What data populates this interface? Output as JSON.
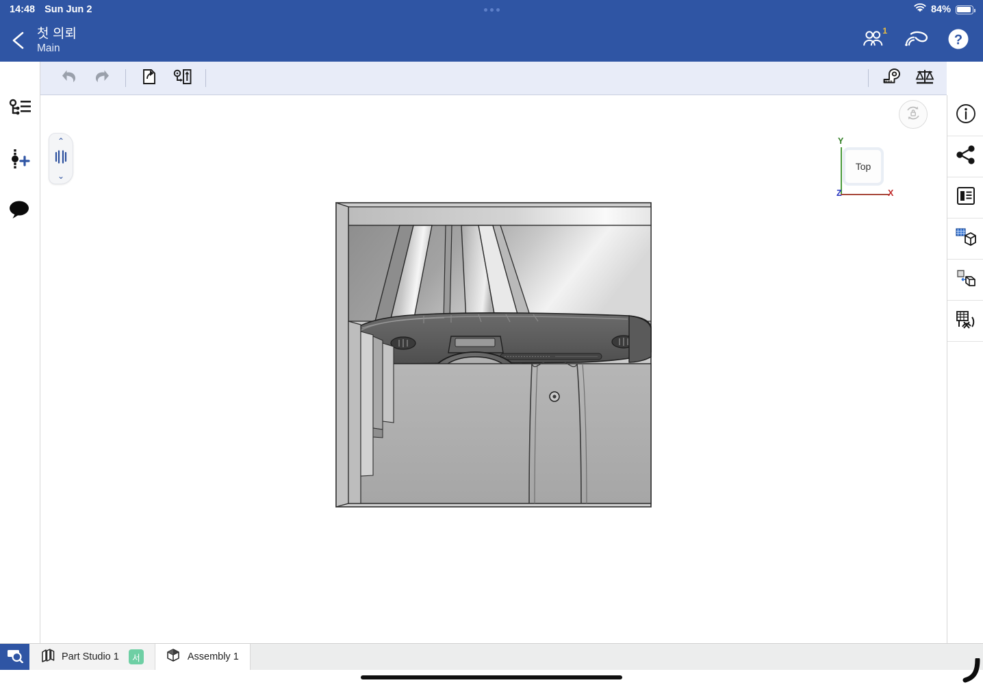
{
  "status_bar": {
    "time": "14:48",
    "date": "Sun Jun 2",
    "battery_percent": "84%",
    "wifi_icon": "wifi-icon",
    "battery_icon": "battery-icon",
    "dots_icon": "more-dots-icon"
  },
  "header": {
    "back_icon": "chevron-left-icon",
    "title": "첫 의뢰",
    "subtitle": "Main",
    "icons": [
      {
        "name": "collaborators-icon",
        "badge": "1"
      },
      {
        "name": "ar-headset-icon",
        "badge": ""
      },
      {
        "name": "help-icon",
        "badge": ""
      }
    ]
  },
  "left_rail": {
    "items": [
      {
        "name": "feature-tree-icon",
        "label": "Feature list"
      },
      {
        "name": "add-feature-icon",
        "label": "Insert feature"
      },
      {
        "name": "comments-icon",
        "label": "Comments"
      }
    ]
  },
  "toolbar": {
    "undo_icon": "undo-icon",
    "redo_icon": "redo-icon",
    "insert_icon": "insert-part-icon",
    "mate_icon": "mate-connector-icon",
    "measure_icon": "measure-tape-icon",
    "mass_icon": "mass-properties-icon"
  },
  "canvas": {
    "rollback": {
      "up_chevron": "⌃",
      "down_chevron": "⌄",
      "handle_icon": "rollback-bar-icon"
    },
    "rotate_lock_icon": "rotation-lock-icon",
    "view_cube": {
      "face_label": "Top",
      "axis_y": "Y",
      "axis_x": "X",
      "axis_z": "Z",
      "color_y": "#4a9a3a",
      "color_x": "#a8493c",
      "color_z": "#2a37c0"
    },
    "model_name": "car-interior-assembly"
  },
  "right_rail": {
    "items": [
      {
        "name": "info-icon",
        "label": "Details"
      },
      {
        "name": "share-icon",
        "label": "Share"
      },
      {
        "name": "properties-icon",
        "label": "Properties"
      },
      {
        "name": "appearance-icon",
        "label": "Appearance"
      },
      {
        "name": "instance-icon",
        "label": "Instances"
      },
      {
        "name": "configurations-icon",
        "label": "Configurations"
      }
    ]
  },
  "tab_bar": {
    "search_icon": "search-tabs-icon",
    "tabs": [
      {
        "label": "Part Studio 1",
        "icon": "part-studio-icon",
        "badge": "서",
        "badge_color": "#6ecfa4",
        "active": false
      },
      {
        "label": "Assembly 1",
        "icon": "assembly-icon",
        "badge": "",
        "badge_color": "",
        "active": true
      }
    ]
  },
  "colors": {
    "brand_blue": "#2f55a4",
    "toolbar_bg": "#e8ecf8",
    "badge_green": "#6ecfa4",
    "badge_yellow": "#f0c13c"
  }
}
